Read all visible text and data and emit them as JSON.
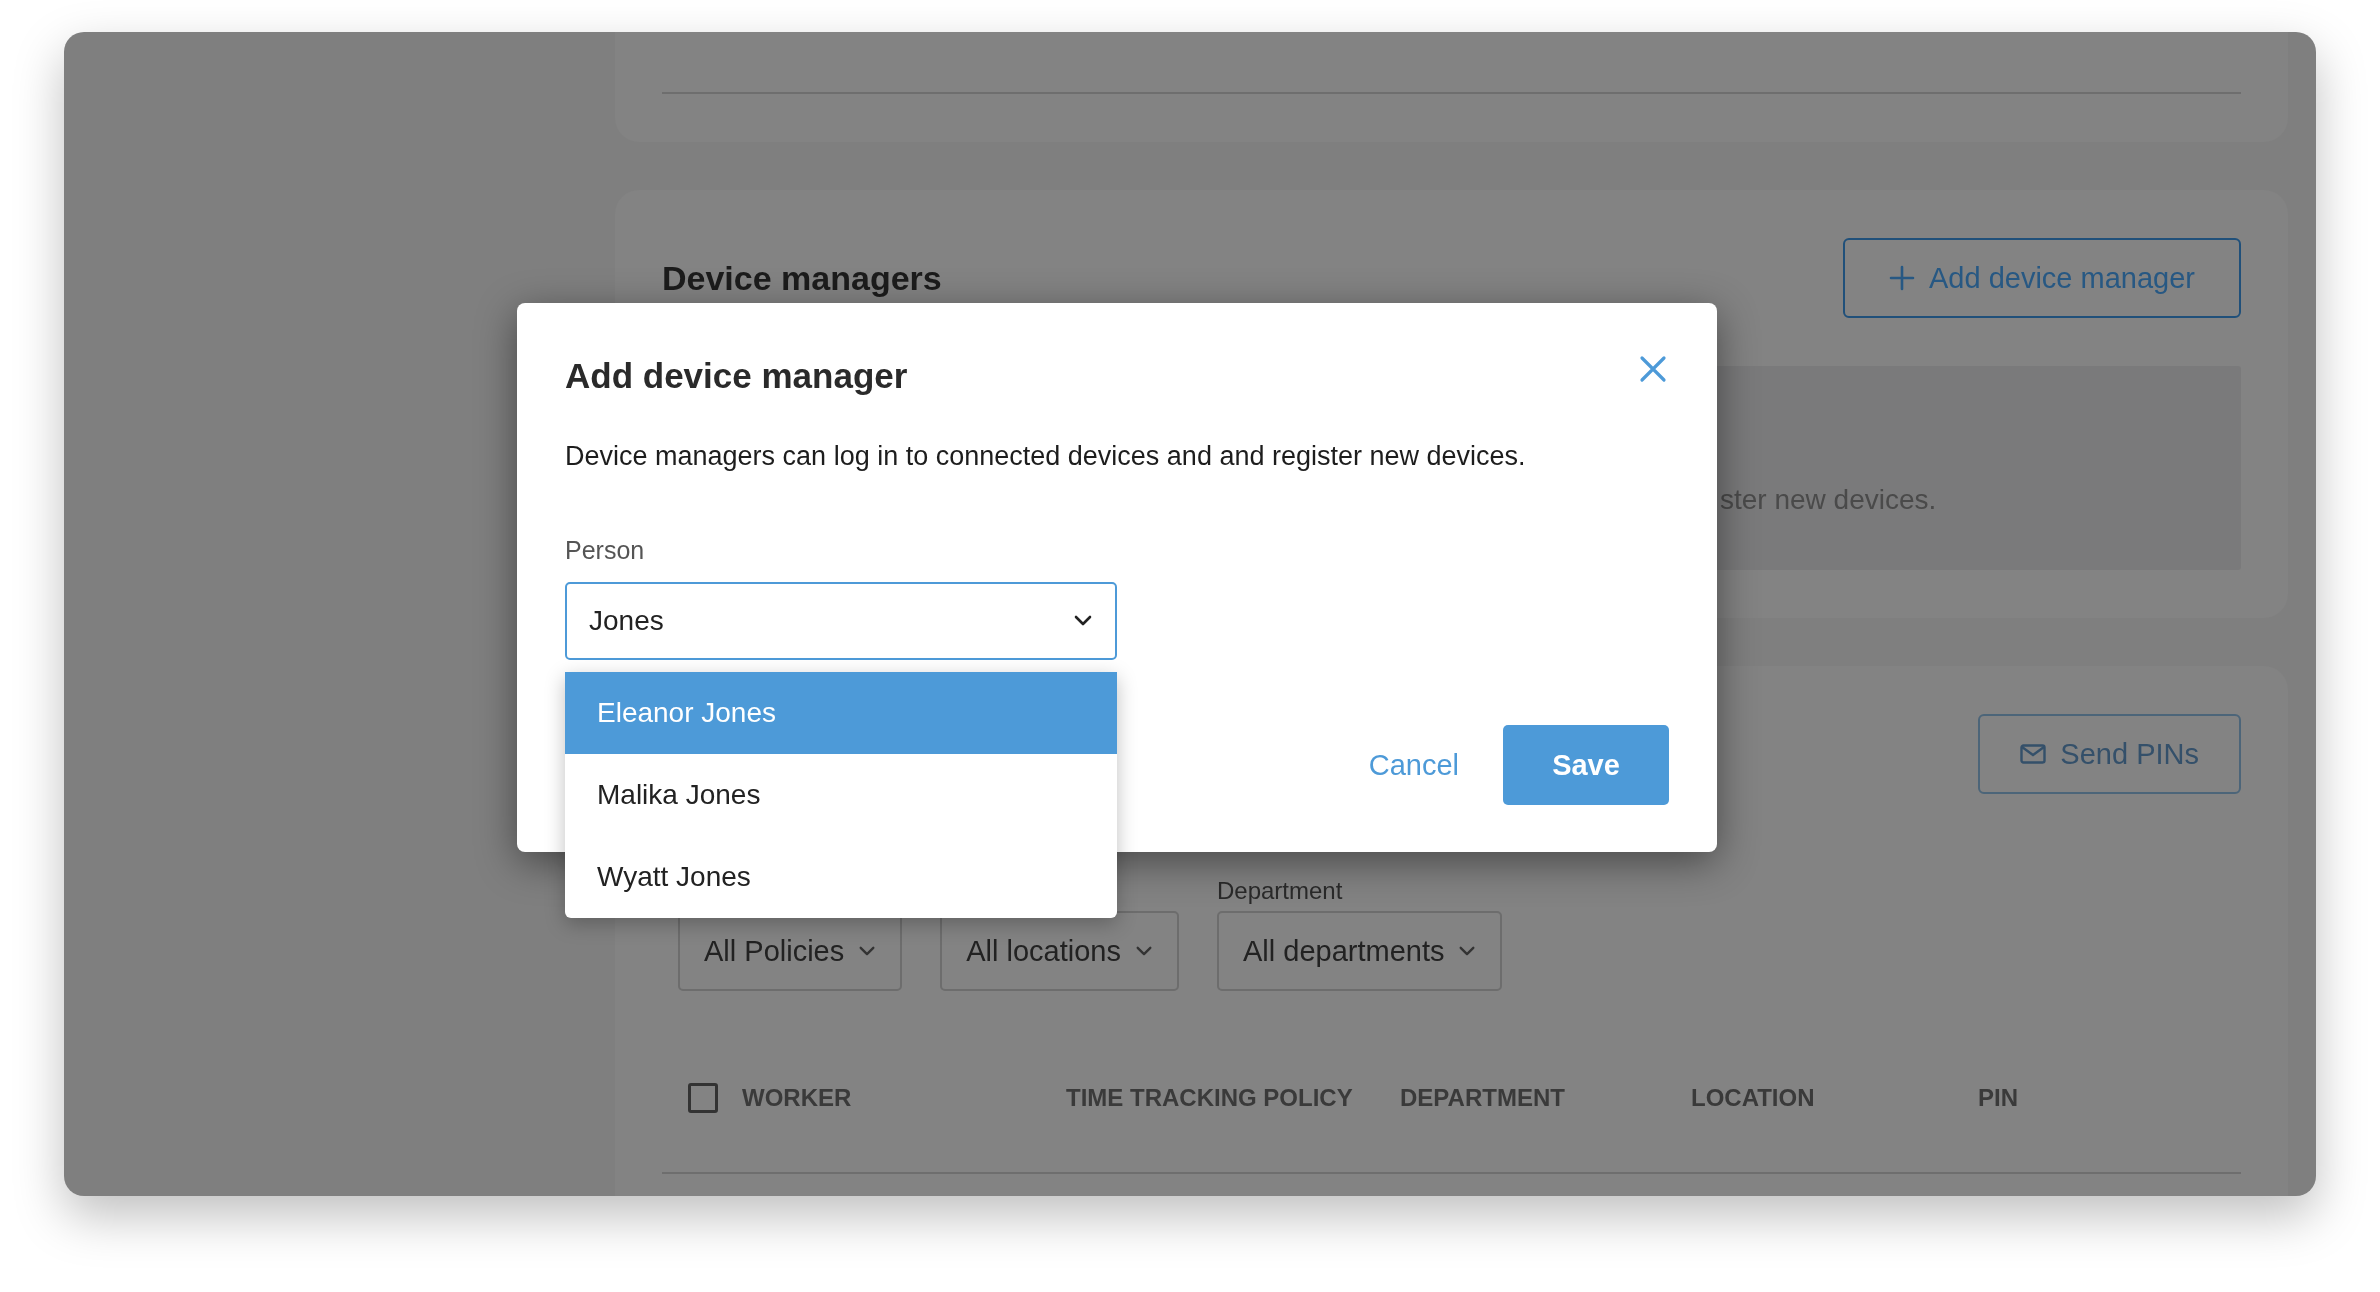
{
  "device_managers": {
    "title": "Device managers",
    "add_button": "Add device manager",
    "info_text": "ster new devices."
  },
  "workers": {
    "send_button": "Send PINs",
    "filters": [
      {
        "value": "All Policies"
      },
      {
        "value": "All locations"
      },
      {
        "label": "Department",
        "value": "All departments"
      }
    ],
    "select_all": {
      "checked": false
    },
    "columns": [
      "WORKER",
      "TIME TRACKING POLICY",
      "DEPARTMENT",
      "LOCATION",
      "PIN"
    ]
  },
  "dialog": {
    "title": "Add device manager",
    "description": "Device managers can log in to connected devices and and register new devices.",
    "field": {
      "label": "Person",
      "value": "Jones"
    },
    "options": [
      {
        "label": "Eleanor Jones",
        "selected": true
      },
      {
        "label": "Malika Jones",
        "selected": false
      },
      {
        "label": "Wyatt Jones",
        "selected": false
      }
    ],
    "cancel": "Cancel",
    "save": "Save"
  }
}
